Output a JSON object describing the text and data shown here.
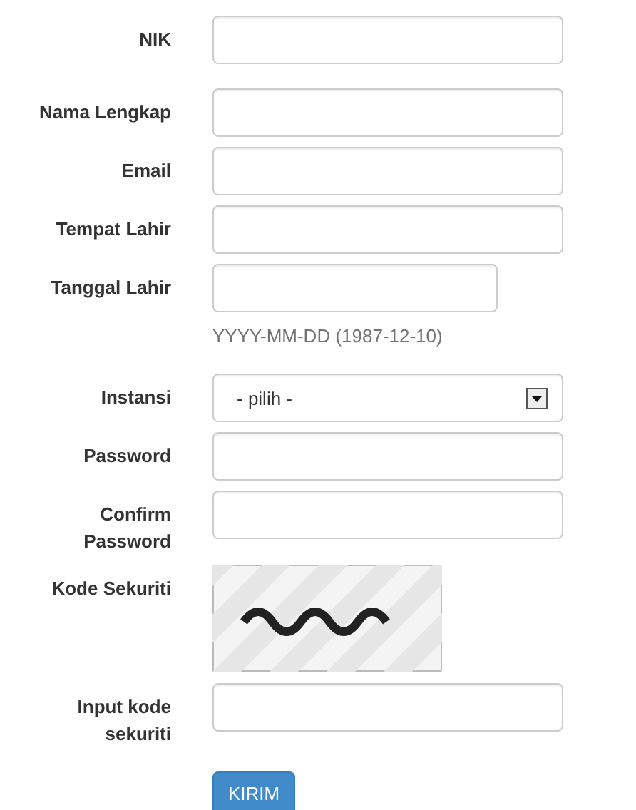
{
  "fields": [
    {
      "kind": "text",
      "label": "NIK"
    },
    {
      "kind": "text",
      "label": "Nama Lengkap"
    },
    {
      "kind": "text",
      "label": "Email"
    },
    {
      "kind": "text",
      "label": "Tempat Lahir"
    },
    {
      "kind": "date",
      "label": "Tanggal Lahir",
      "help": "YYYY-MM-DD (1987-12-10)"
    },
    {
      "kind": "select",
      "label": "Instansi",
      "value": "- pilih -"
    },
    {
      "kind": "password",
      "label": "Password"
    },
    {
      "kind": "password",
      "label": "Confirm Password"
    },
    {
      "kind": "captcha",
      "label": "Kode Sekuriti"
    },
    {
      "kind": "text",
      "label": "Input kode sekuriti"
    }
  ],
  "submit": {
    "label": "KIRIM"
  }
}
